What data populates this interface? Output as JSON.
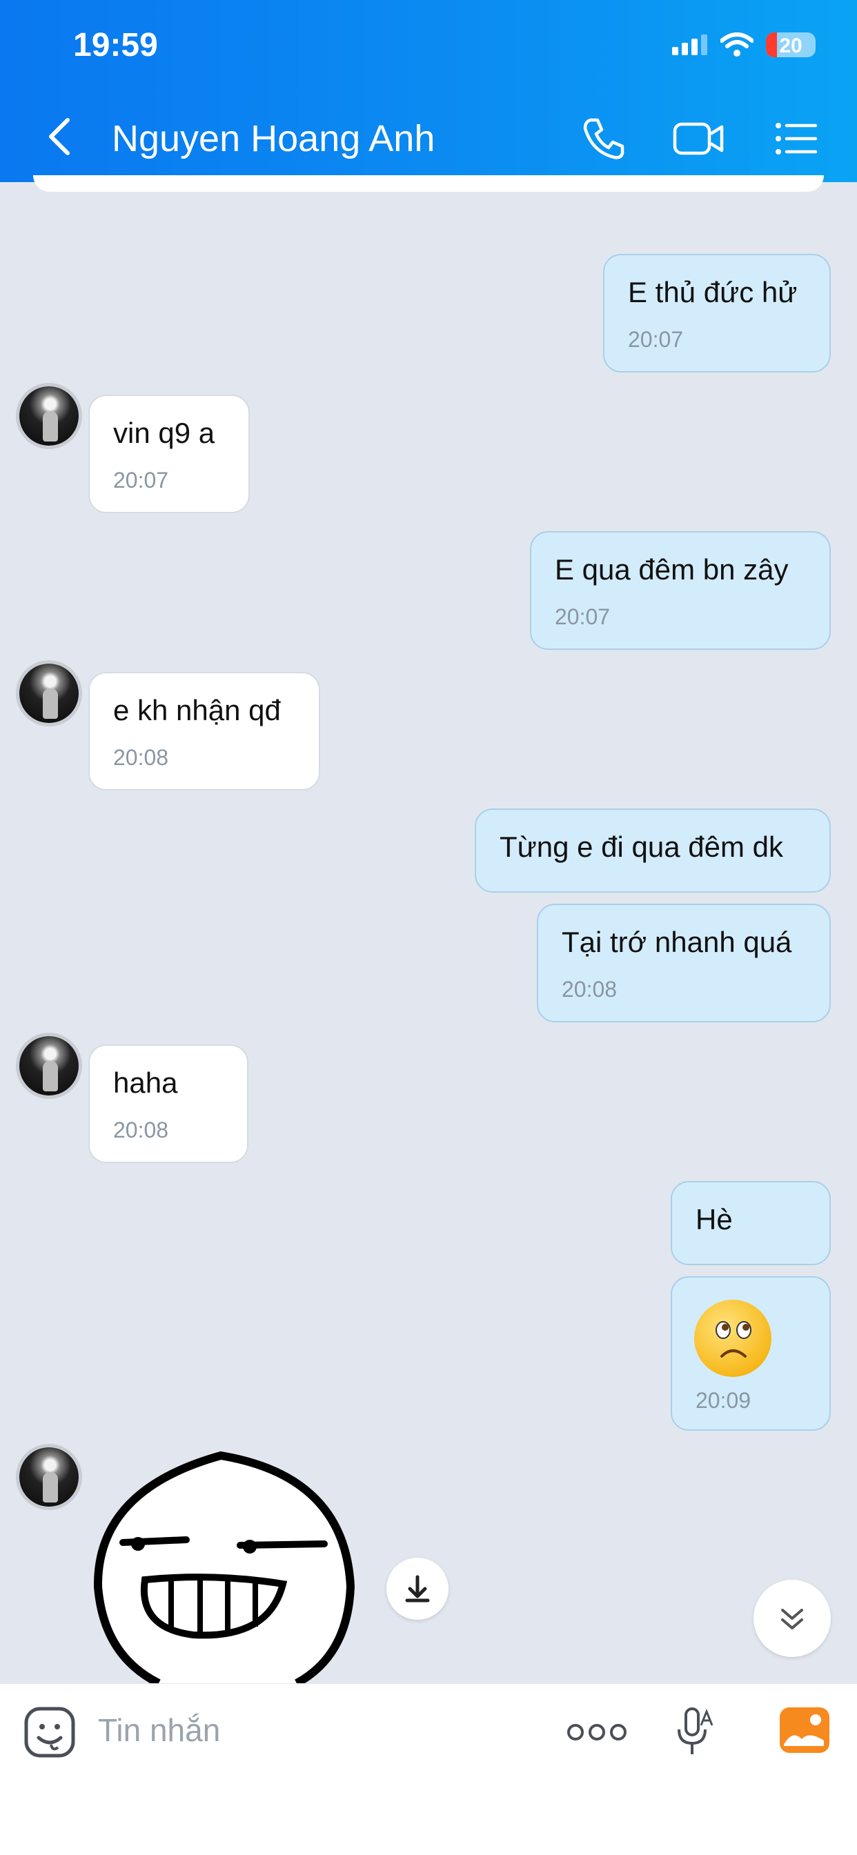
{
  "status_bar": {
    "time": "19:59",
    "battery": "20"
  },
  "header": {
    "contact_name": "Nguyen Hoang Anh"
  },
  "messages": [
    {
      "text": "E thủ đức hử",
      "time": "20:07"
    },
    {
      "text": "vin q9 a",
      "time": "20:07"
    },
    {
      "text": "E qua đêm bn zây",
      "time": "20:07"
    },
    {
      "text": "e kh nhận qđ",
      "time": "20:08"
    },
    {
      "text": "Từng e đi qua đêm dk",
      "time": ""
    },
    {
      "text": "Tại trớ nhanh quá",
      "time": "20:08"
    },
    {
      "text": "haha",
      "time": "20:08"
    },
    {
      "text": "Hè",
      "time": ""
    },
    {
      "text": "",
      "time": "20:09"
    }
  ],
  "composer": {
    "placeholder": "Tin nhắn"
  },
  "colors": {
    "header_start": "#0a78f0",
    "header_end": "#0aa3f4",
    "outgoing_bubble": "#d3ecfb",
    "chat_background": "#e2e7ef"
  },
  "icons": [
    "back-icon",
    "phone-icon",
    "video-icon",
    "menu-list-icon",
    "download-icon",
    "scroll-down-icon",
    "sticker-icon",
    "more-icon",
    "voice-icon",
    "image-icon"
  ]
}
